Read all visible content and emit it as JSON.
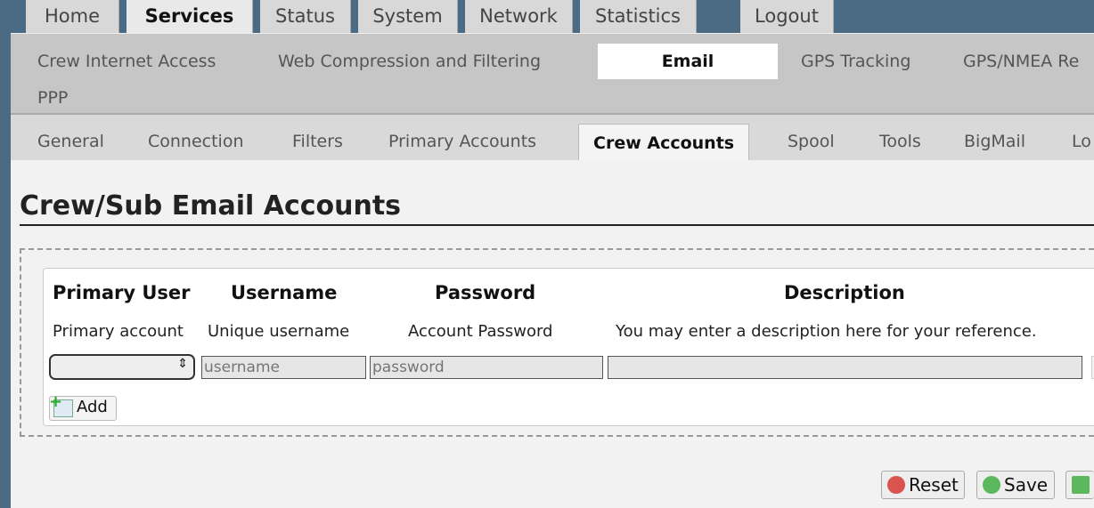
{
  "top_tabs": [
    {
      "label": "Home",
      "active": false
    },
    {
      "label": "Services",
      "active": true
    },
    {
      "label": "Status",
      "active": false
    },
    {
      "label": "System",
      "active": false
    },
    {
      "label": "Network",
      "active": false
    },
    {
      "label": "Statistics",
      "active": false
    },
    {
      "label": "Logout",
      "active": false
    }
  ],
  "sub_nav": [
    {
      "label": "Crew Internet Access",
      "active": false
    },
    {
      "label": "Web Compression and Filtering",
      "active": false
    },
    {
      "label": "Email",
      "active": true
    },
    {
      "label": "GPS Tracking",
      "active": false
    },
    {
      "label": "GPS/NMEA Re",
      "active": false
    },
    {
      "label": "PPP",
      "active": false
    }
  ],
  "email_tabs": [
    {
      "label": "General",
      "active": false
    },
    {
      "label": "Connection",
      "active": false
    },
    {
      "label": "Filters",
      "active": false
    },
    {
      "label": "Primary Accounts",
      "active": false
    },
    {
      "label": "Crew Accounts",
      "active": true
    },
    {
      "label": "Spool",
      "active": false
    },
    {
      "label": "Tools",
      "active": false
    },
    {
      "label": "BigMail",
      "active": false
    },
    {
      "label": "Lo",
      "active": false
    }
  ],
  "page_title": "Crew/Sub Email Accounts",
  "table": {
    "columns": [
      {
        "header": "Primary User",
        "hint": "Primary account"
      },
      {
        "header": "Username",
        "hint": "Unique username"
      },
      {
        "header": "Password",
        "hint": "Account Password"
      },
      {
        "header": "Description",
        "hint": "You may enter a description here for your reference."
      }
    ],
    "row": {
      "primary_user_value": "",
      "username_placeholder": "username",
      "password_placeholder": "password",
      "description_value": ""
    },
    "add_label": "Add"
  },
  "actions": {
    "reset_label": "Reset",
    "save_label": "Save"
  },
  "colors": {
    "background": "#4b6a83",
    "reset_icon": "#d9534f",
    "save_icon": "#5cb85c",
    "next_icon": "#5cb85c"
  }
}
